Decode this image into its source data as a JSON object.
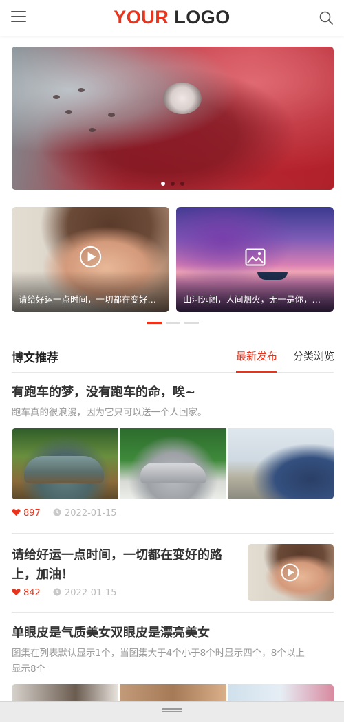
{
  "header": {
    "logo_part1": "YOUR",
    "logo_part2": "LOGO",
    "menu_icon": "hamburger-menu-icon",
    "search_icon": "search-icon"
  },
  "hero": {
    "slide_count": 3,
    "active_slide": 1
  },
  "feature_cards": [
    {
      "caption": "请给好运一点时间，一切都在变好的路上，加油！",
      "icon": "play-icon"
    },
    {
      "caption": "山河远阔，人间烟火，无一是你，无一不是你",
      "icon": "image-icon"
    }
  ],
  "feature_pager": {
    "count": 3,
    "active": 1
  },
  "section": {
    "title": "博文推荐",
    "tabs": [
      "最新发布",
      "分类浏览"
    ],
    "active_tab": "最新发布"
  },
  "posts": [
    {
      "title": "有跑车的梦，没有跑车的命，唉~",
      "excerpt": "跑车真的很浪漫，因为它只可以送一个人回家。",
      "likes": "897",
      "date": "2022-01-15"
    },
    {
      "title_line1": "请给好运一点时间，一切都在变好的路",
      "title_line2": "上，加油！",
      "likes": "842",
      "date": "2022-01-15"
    },
    {
      "title": "单眼皮是气质美女双眼皮是漂亮美女",
      "excerpt_line1": "图集在列表默认显示1个，当图集大于4个小于8个时显示四个，8个以上",
      "excerpt_line2": "显示8个"
    }
  ],
  "colors": {
    "accent": "#e8341c",
    "text": "#333333",
    "muted": "#999999"
  }
}
